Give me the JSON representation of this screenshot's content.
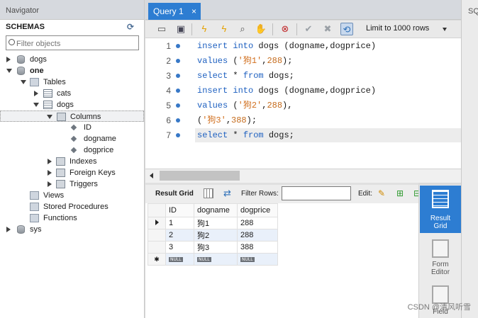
{
  "navigator": {
    "title": "Navigator",
    "schemas_label": "SCHEMAS",
    "filter_placeholder": "Filter objects",
    "tree": {
      "dogs_schema": "dogs",
      "one_schema": "one",
      "tables": "Tables",
      "cats": "cats",
      "dogs": "dogs",
      "columns": "Columns",
      "col_id": "ID",
      "col_dogname": "dogname",
      "col_dogprice": "dogprice",
      "indexes": "Indexes",
      "foreign_keys": "Foreign Keys",
      "triggers": "Triggers",
      "views": "Views",
      "stored_procedures": "Stored Procedures",
      "functions": "Functions",
      "sys_schema": "sys"
    }
  },
  "tabs": {
    "query_tab": "Query 1",
    "close": "×",
    "right_panel_title": "SQ"
  },
  "toolbar": {
    "limit_label": "Limit to 1000 rows"
  },
  "editor": {
    "line_numbers": [
      "1",
      "2",
      "3",
      "4",
      "5",
      "6",
      "7"
    ],
    "lines": [
      [
        [
          "kw",
          "insert into "
        ],
        [
          "pl",
          "dogs (dogname,dogprice)"
        ]
      ],
      [
        [
          "kw",
          "values "
        ],
        [
          "pl",
          "("
        ],
        [
          "str",
          "'狗1'"
        ],
        [
          "pl",
          ","
        ],
        [
          "num",
          "288"
        ],
        [
          "pl",
          ");"
        ]
      ],
      [
        [
          "kw",
          "select "
        ],
        [
          "pl",
          "* "
        ],
        [
          "kw",
          "from "
        ],
        [
          "pl",
          "dogs;"
        ]
      ],
      [
        [
          "kw",
          "insert into "
        ],
        [
          "pl",
          "dogs (dogname,dogprice)"
        ]
      ],
      [
        [
          "kw",
          "values "
        ],
        [
          "pl",
          "("
        ],
        [
          "str",
          "'狗2'"
        ],
        [
          "pl",
          ","
        ],
        [
          "num",
          "288"
        ],
        [
          "pl",
          "),"
        ]
      ],
      [
        [
          "pl",
          "("
        ],
        [
          "str",
          "'狗3'"
        ],
        [
          "pl",
          ","
        ],
        [
          "num",
          "388"
        ],
        [
          "pl",
          ");"
        ]
      ],
      [
        [
          "kw",
          "select "
        ],
        [
          "pl",
          "* "
        ],
        [
          "kw",
          "from "
        ],
        [
          "pl",
          "dogs;"
        ]
      ]
    ]
  },
  "results_toolbar": {
    "result_grid_label": "Result Grid",
    "filter_rows_label": "Filter Rows:",
    "filter_rows_value": "",
    "edit_label": "Edit:"
  },
  "grid": {
    "columns": [
      "ID",
      "dogname",
      "dogprice"
    ],
    "rows": [
      [
        "1",
        "狗1",
        "288"
      ],
      [
        "2",
        "狗2",
        "288"
      ],
      [
        "3",
        "狗3",
        "388"
      ]
    ],
    "null_label": "NULL"
  },
  "side_panel": {
    "result_grid_1": "Result",
    "result_grid_2": "Grid",
    "form_editor_1": "Form",
    "form_editor_2": "Editor",
    "field_types": "Field"
  },
  "watermark": "CSDN @清风听雪"
}
